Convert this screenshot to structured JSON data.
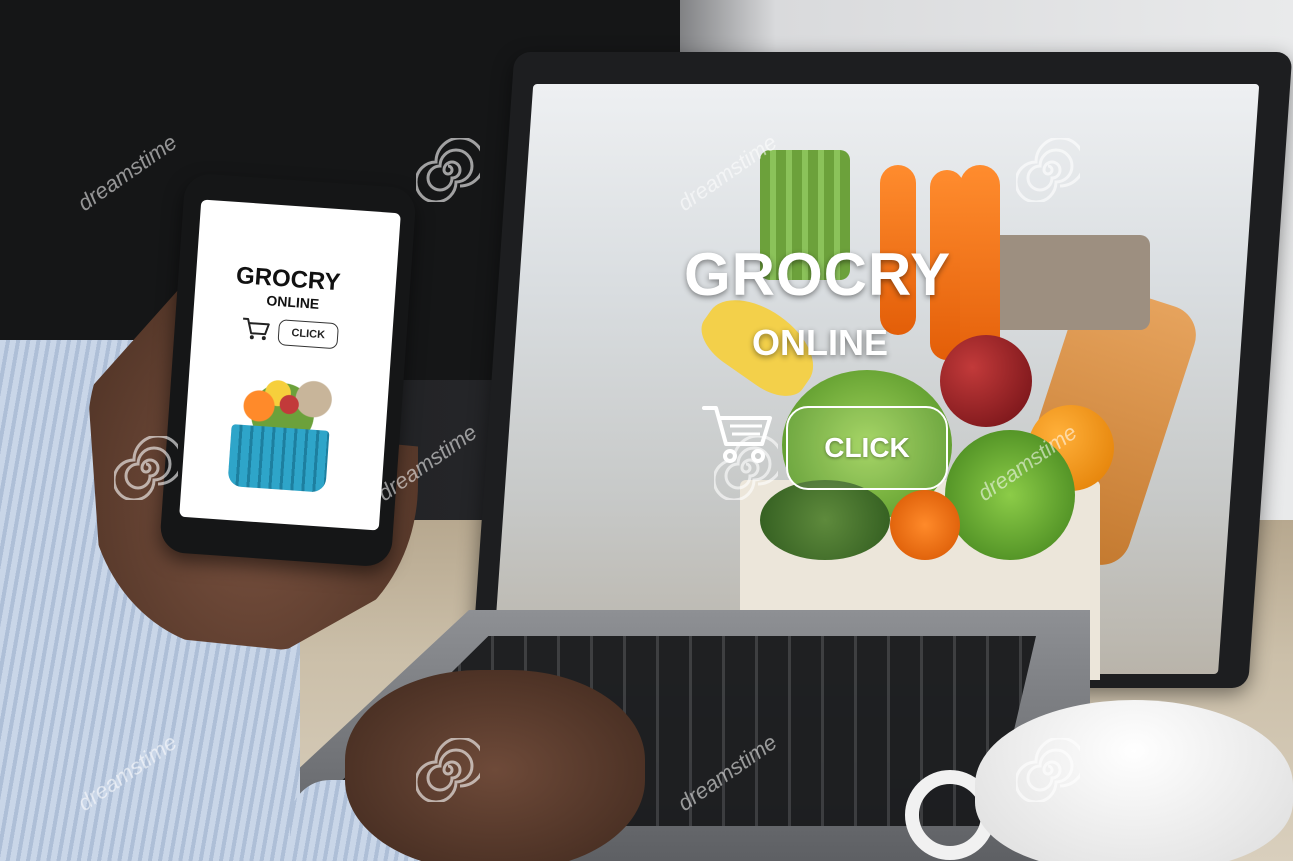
{
  "laptop_site": {
    "title": "GROCRY",
    "subtitle": "ONLINE",
    "cart_icon": "shopping-cart-icon",
    "click_label": "CLICK"
  },
  "phone_site": {
    "title": "GROCRY",
    "subtitle": "ONLINE",
    "cart_icon": "shopping-cart-icon",
    "click_label": "CLICK"
  },
  "watermark": {
    "text": "dreamstime",
    "logo_icon": "spiral-logo-icon"
  },
  "colors": {
    "button_border_laptop": "#ffffff",
    "basket": "#2ea5c9",
    "cart_stroke_phone": "#222222"
  }
}
